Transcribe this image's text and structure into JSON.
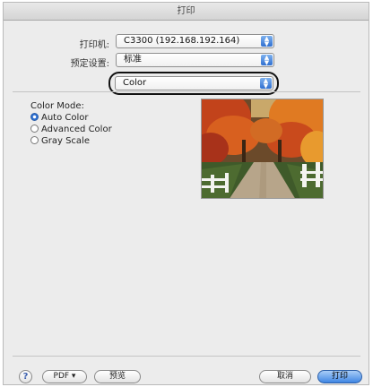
{
  "window": {
    "title": "打印"
  },
  "printer": {
    "label": "打印机:",
    "value": "C3300 (192.168.192.164)"
  },
  "presets": {
    "label": "预定设置:",
    "value": "标准"
  },
  "panel_select": {
    "value": "Color"
  },
  "color_mode": {
    "title": "Color Mode:",
    "options": [
      {
        "label": "Auto Color",
        "selected": true
      },
      {
        "label": "Advanced Color",
        "selected": false
      },
      {
        "label": "Gray Scale",
        "selected": false
      }
    ]
  },
  "footer": {
    "help": "?",
    "pdf_label": "PDF ▾",
    "preview_label": "预览",
    "cancel_label": "取消",
    "print_label": "打印"
  },
  "colors": {
    "accent": "#3f86e3"
  }
}
